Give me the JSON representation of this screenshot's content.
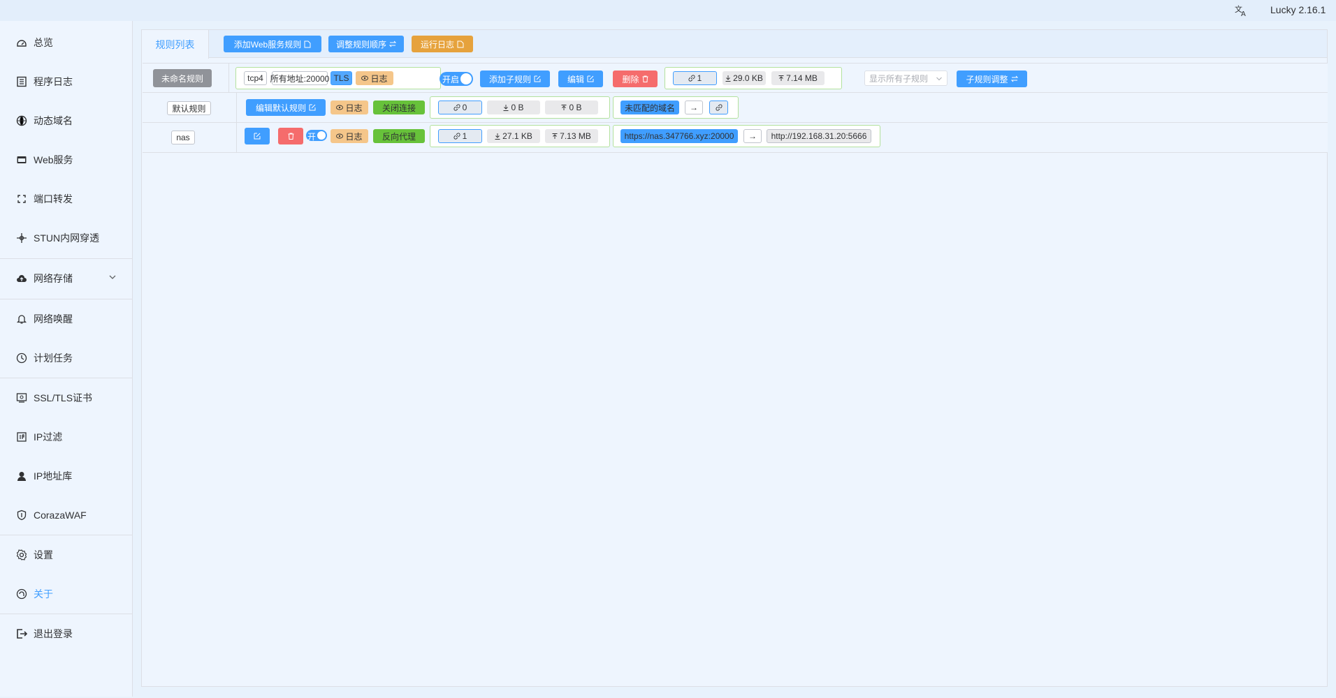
{
  "app": {
    "version": "Lucky 2.16.1"
  },
  "sidebar": {
    "items": [
      {
        "label": "总览",
        "icon": "dashboard-icon"
      },
      {
        "label": "程序日志",
        "icon": "log-icon"
      },
      {
        "label": "动态域名",
        "icon": "dns-icon"
      },
      {
        "label": "Web服务",
        "icon": "web-service-icon"
      },
      {
        "label": "端口转发",
        "icon": "port-forward-icon"
      },
      {
        "label": "STUN内网穿透",
        "icon": "stun-icon"
      },
      {
        "label": "网络存储",
        "icon": "cloud-storage-icon"
      },
      {
        "label": "网络唤醒",
        "icon": "bell-icon"
      },
      {
        "label": "计划任务",
        "icon": "clock-icon"
      },
      {
        "label": "SSL/TLS证书",
        "icon": "certificate-icon"
      },
      {
        "label": "IP过滤",
        "icon": "ip-filter-icon"
      },
      {
        "label": "IP地址库",
        "icon": "ip-database-icon"
      },
      {
        "label": "CorazaWAF",
        "icon": "shield-icon"
      },
      {
        "label": "设置",
        "icon": "gear-icon"
      },
      {
        "label": "关于",
        "icon": "about-icon"
      },
      {
        "label": "退出登录",
        "icon": "logout-icon"
      }
    ],
    "active": "关于"
  },
  "toolbar": {
    "tab_label": "规则列表",
    "add_rule": "添加Web服务规则",
    "reorder": "调整规则顺序",
    "run_log": "运行日志"
  },
  "rule": {
    "name": "未命名规则",
    "protocol": "tcp4",
    "listen": "所有地址:20000",
    "tls": "TLS",
    "log": "日志",
    "switch": "开启",
    "add_sub": "添加子规则",
    "edit": "编辑",
    "delete": "删除",
    "stats": {
      "connections": "1",
      "download": "29.0 KB",
      "upload": "7.14 MB"
    },
    "filter_placeholder": "显示所有子规则",
    "sub_adjust": "子规则调整"
  },
  "default_rule": {
    "name": "默认规则",
    "edit": "编辑默认规则",
    "log": "日志",
    "action": "关闭连接",
    "stats": {
      "connections": "0",
      "download": "0 B",
      "upload": "0 B"
    },
    "unmatched": "未匹配的域名",
    "arrow": "→"
  },
  "sub_rule": {
    "name": "nas",
    "switch": "开",
    "log": "日志",
    "type": "反向代理",
    "stats": {
      "connections": "1",
      "download": "27.1 KB",
      "upload": "7.13 MB"
    },
    "source": "https://nas.347766.xyz:20000",
    "arrow": "→",
    "target": "http://192.168.31.20:5666"
  },
  "colors": {
    "primary": "#409eff",
    "warning": "#e6a23c",
    "danger": "#f56c6c",
    "success": "#67c23a"
  }
}
